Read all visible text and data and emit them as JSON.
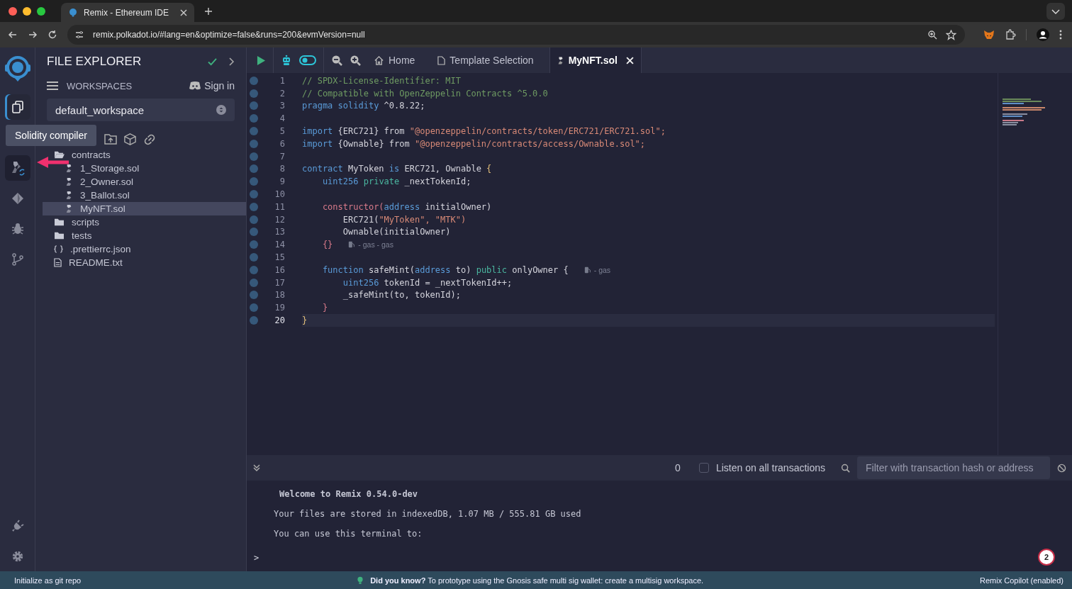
{
  "browser": {
    "tab_title": "Remix - Ethereum IDE",
    "url": "remix.polkadot.io/#lang=en&optimize=false&runs=200&evmVersion=null"
  },
  "icon_bar": {
    "items": [
      {
        "kind": "files",
        "selected": true,
        "hovered": false
      },
      {
        "kind": "compiler",
        "selected": false,
        "hovered": true
      },
      {
        "kind": "deploy",
        "selected": false,
        "hovered": false
      },
      {
        "kind": "debug",
        "selected": false,
        "hovered": false
      },
      {
        "kind": "git",
        "selected": false,
        "hovered": false
      }
    ],
    "bottom_items": [
      {
        "kind": "plugin"
      },
      {
        "kind": "settings"
      }
    ],
    "tooltip": "Solidity compiler"
  },
  "side_panel": {
    "title": "FILE EXPLORER",
    "workspaces_label": "WORKSPACES",
    "sign_in": "Sign in",
    "workspace": "default_workspace",
    "tree": [
      {
        "name": "contracts",
        "kind": "folder",
        "expanded": true,
        "selected": false,
        "children": [
          {
            "name": "1_Storage.sol",
            "kind": "sol",
            "selected": false
          },
          {
            "name": "2_Owner.sol",
            "kind": "sol",
            "selected": false
          },
          {
            "name": "3_Ballot.sol",
            "kind": "sol",
            "selected": false
          },
          {
            "name": "MyNFT.sol",
            "kind": "sol",
            "selected": true
          }
        ]
      },
      {
        "name": "scripts",
        "kind": "folder",
        "expanded": false,
        "selected": false
      },
      {
        "name": "tests",
        "kind": "folder",
        "expanded": false,
        "selected": false
      },
      {
        "name": ".prettierrc.json",
        "kind": "json",
        "selected": false
      },
      {
        "name": "README.txt",
        "kind": "txt",
        "selected": false
      }
    ]
  },
  "editor": {
    "tabs": [
      {
        "label": "Home",
        "kind": "home",
        "selected": false
      },
      {
        "label": "Template Selection",
        "kind": "file",
        "selected": false
      },
      {
        "label": "MyNFT.sol",
        "kind": "sol",
        "selected": true
      }
    ],
    "lines": [
      {
        "number": "1",
        "active": false,
        "tokens": [
          {
            "t": "// SPDX-License-Identifier: MIT",
            "color": "#6e9a62"
          }
        ]
      },
      {
        "number": "2",
        "active": false,
        "tokens": [
          {
            "t": "// Compatible with OpenZeppelin Contracts ^5.0.0",
            "color": "#6e9a62"
          }
        ]
      },
      {
        "number": "3",
        "active": false,
        "tokens": [
          {
            "t": "pragma",
            "color": "#5a9bd8"
          },
          {
            "t": " solidity",
            "color": "#5a9bd8"
          },
          {
            "t": " ^0.8.22;",
            "color": "#d4d4dc"
          }
        ]
      },
      {
        "number": "4",
        "active": false
      },
      {
        "number": "5",
        "active": false,
        "tokens": [
          {
            "t": "import",
            "color": "#5a9bd8"
          },
          {
            "t": " {ERC721} from ",
            "color": "#d4d4dc"
          },
          {
            "t": "\"@openzeppelin/contracts/token/ERC721/ERC721.sol\";",
            "color": "#d98a77"
          }
        ]
      },
      {
        "number": "6",
        "active": false,
        "tokens": [
          {
            "t": "import",
            "color": "#5a9bd8"
          },
          {
            "t": " {Ownable} from ",
            "color": "#d4d4dc"
          },
          {
            "t": "\"@openzeppelin/contracts/access/Ownable.sol\";",
            "color": "#d98a77"
          }
        ]
      },
      {
        "number": "7",
        "active": false
      },
      {
        "number": "8",
        "active": false,
        "tokens": [
          {
            "t": "contract",
            "color": "#5a9bd8"
          },
          {
            "t": " MyToken ",
            "color": "#d4d4dc"
          },
          {
            "t": "is",
            "color": "#5a9bd8"
          },
          {
            "t": " ERC721, Ownable ",
            "color": "#d4d4dc"
          },
          {
            "t": "{",
            "color": "#e5c07b"
          }
        ]
      },
      {
        "number": "9",
        "active": false,
        "tokens": [
          {
            "t": "    uint256",
            "color": "#5a9bd8"
          },
          {
            "t": " private",
            "color": "#4bb7a0"
          },
          {
            "t": " _nextTokenId;",
            "color": "#d4d4dc"
          }
        ]
      },
      {
        "number": "10",
        "active": false
      },
      {
        "number": "11",
        "active": false,
        "tokens": [
          {
            "t": "    constructor(",
            "color": "#d97a8a"
          },
          {
            "t": "address",
            "color": "#5a9bd8"
          },
          {
            "t": " initialOwner)",
            "color": "#d4d4dc"
          }
        ]
      },
      {
        "number": "12",
        "active": false,
        "tokens": [
          {
            "t": "        ERC721(",
            "color": "#d4d4dc"
          },
          {
            "t": "\"MyToken\", \"MTK\")",
            "color": "#d98a77"
          }
        ]
      },
      {
        "number": "13",
        "active": false,
        "tokens": [
          {
            "t": "        Ownable(initialOwner)",
            "color": "#d4d4dc"
          }
        ]
      },
      {
        "number": "14",
        "active": false,
        "tokens": [
          {
            "t": "    {}",
            "color": "#d97a8a"
          }
        ],
        "gas_hint": "- gas - gas"
      },
      {
        "number": "15",
        "active": false
      },
      {
        "number": "16",
        "active": false,
        "tokens": [
          {
            "t": "    function",
            "color": "#5a9bd8"
          },
          {
            "t": " safeMint(",
            "color": "#d4d4dc"
          },
          {
            "t": "address",
            "color": "#5a9bd8"
          },
          {
            "t": " to)",
            "color": "#d4d4dc"
          },
          {
            "t": " public",
            "color": "#4bb7a0"
          },
          {
            "t": " onlyOwner {",
            "color": "#d4d4dc"
          }
        ],
        "gas_hint": "- gas"
      },
      {
        "number": "17",
        "active": false,
        "tokens": [
          {
            "t": "        uint256",
            "color": "#5a9bd8"
          },
          {
            "t": " tokenId = _nextTokenId++;",
            "color": "#d4d4dc"
          }
        ]
      },
      {
        "number": "18",
        "active": false,
        "tokens": [
          {
            "t": "        _safeMint(to, tokenId);",
            "color": "#d4d4dc"
          }
        ]
      },
      {
        "number": "19",
        "active": false,
        "tokens": [
          {
            "t": "    }",
            "color": "#d97a8a"
          }
        ]
      },
      {
        "number": "20",
        "active": true,
        "tokens": [
          {
            "t": "}",
            "color": "#e5c07b"
          }
        ]
      }
    ]
  },
  "terminal": {
    "count": "0",
    "listen": {
      "label": "Listen on all transactions",
      "checked": false
    },
    "filter_placeholder": "Filter with transaction hash or address",
    "messages": [
      {
        "kind": "bold",
        "text": "Welcome to Remix 0.54.0-dev"
      },
      {
        "kind": "plain",
        "text": "Your files are stored in indexedDB, 1.07 MB / 555.81 GB used"
      },
      {
        "kind": "plain",
        "text": "You can use this terminal to:"
      }
    ],
    "prompt": ">",
    "badge": "2"
  },
  "status_bar": {
    "left": "Initialize as git repo",
    "tip": "**Did you know?** To prototype using the Gnosis safe multi sig wallet: create a multisig workspace.",
    "right": "Remix Copilot (enabled)"
  }
}
